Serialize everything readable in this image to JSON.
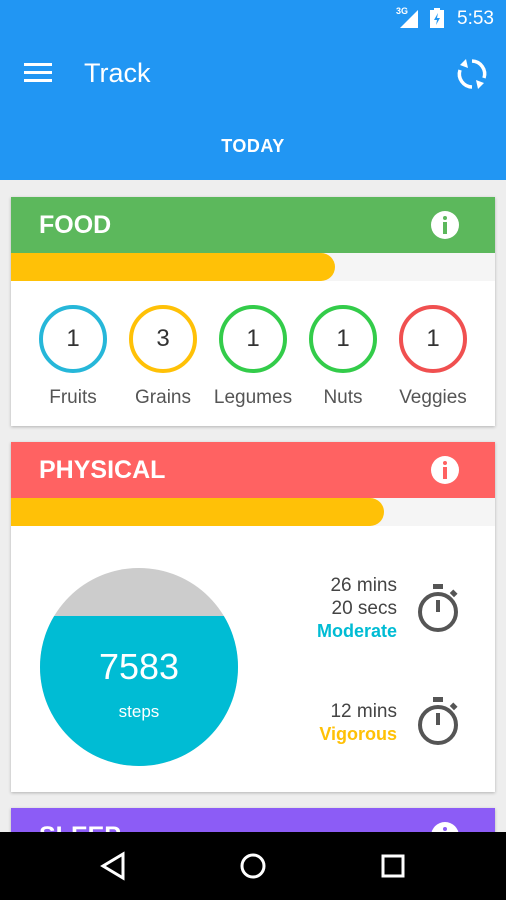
{
  "status_bar": {
    "network": "3G",
    "time": "5:53"
  },
  "app_bar": {
    "title": "Track",
    "tab": "TODAY"
  },
  "food": {
    "title": "FOOD",
    "progress": 0.67,
    "items": [
      {
        "label": "Fruits",
        "count": "1",
        "color": "#26b7d9"
      },
      {
        "label": "Grains",
        "count": "3",
        "color": "#ffc107"
      },
      {
        "label": "Legumes",
        "count": "1",
        "color": "#33cc4a"
      },
      {
        "label": "Nuts",
        "count": "1",
        "color": "#33cc4a"
      },
      {
        "label": "Veggies",
        "count": "1",
        "color": "#f05050"
      }
    ]
  },
  "physical": {
    "title": "PHYSICAL",
    "progress": 0.77,
    "steps": {
      "value": "7583",
      "unit": "steps",
      "fill": 0.76
    },
    "moderate": {
      "line1": "26 mins",
      "line2": "20 secs",
      "level": "Moderate",
      "color": "#00bcd4"
    },
    "vigorous": {
      "line1": "12 mins",
      "level": "Vigorous",
      "color": "#ffc107"
    }
  },
  "sleep": {
    "title": "SLEEP"
  },
  "colors": {
    "primary": "#2196f3",
    "food": "#5cb85c",
    "physical": "#ff6262",
    "sleep": "#8c5cf6",
    "progress": "#ffc107"
  },
  "icons": [
    "menu-icon",
    "sync-icon",
    "info-icon",
    "stopwatch-icon",
    "back-icon",
    "home-icon",
    "recents-icon"
  ]
}
